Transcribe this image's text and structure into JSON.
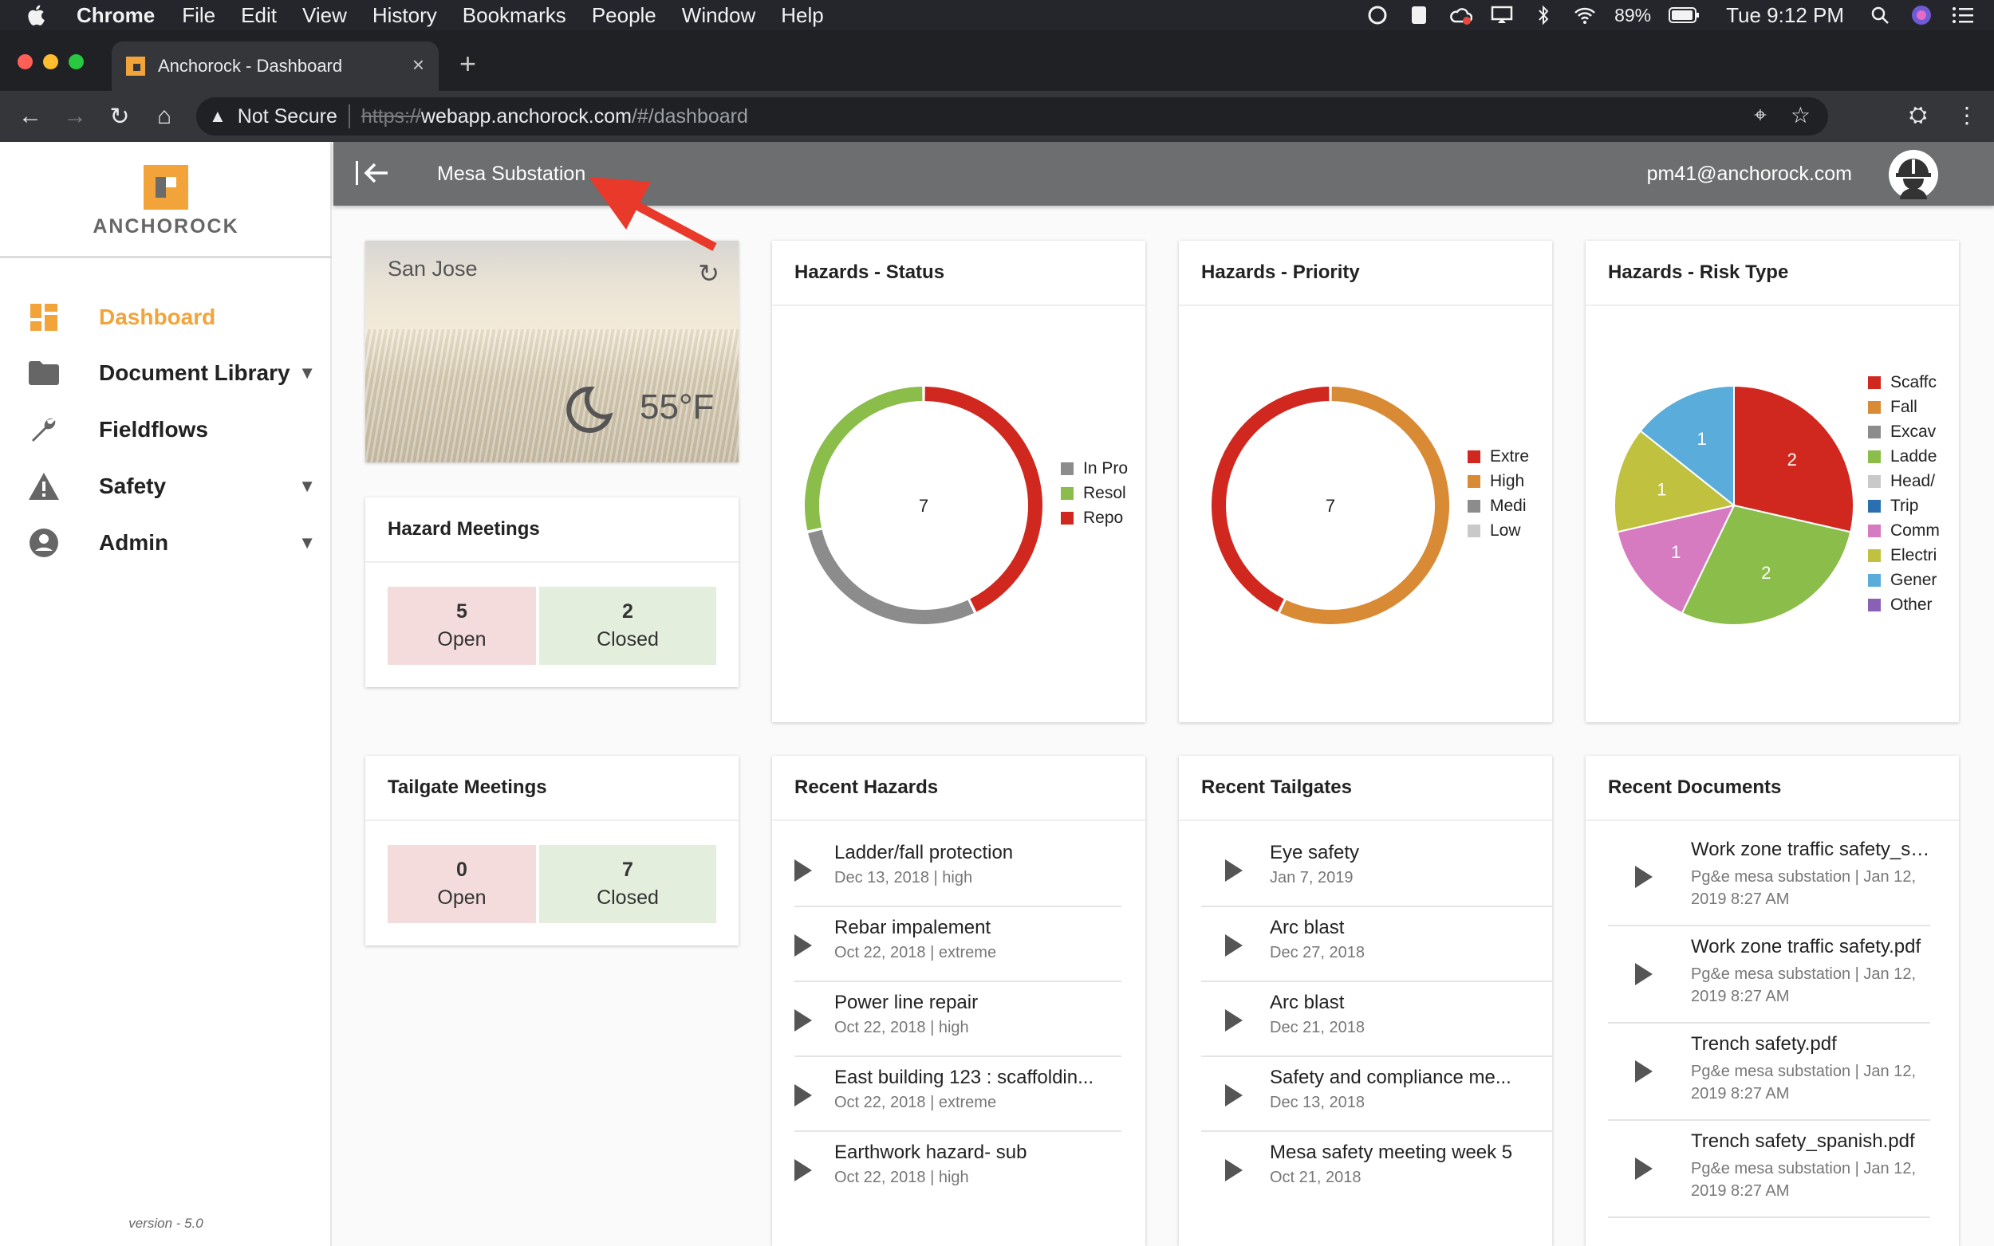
{
  "menubar": {
    "app": "Chrome",
    "items": [
      "File",
      "Edit",
      "View",
      "History",
      "Bookmarks",
      "People",
      "Window",
      "Help"
    ],
    "battery": "89%",
    "clock": "Tue 9:12 PM"
  },
  "browser": {
    "tab_title": "Anchorock - Dashboard",
    "security_label": "Not Secure",
    "url_scheme": "https://",
    "url_host": "webapp.anchorock.com",
    "url_path": "/#/dashboard"
  },
  "sidebar": {
    "brand": "ANCHOROCK",
    "items": [
      {
        "label": "Dashboard",
        "icon": "dashboard-icon",
        "active": true
      },
      {
        "label": "Document Library",
        "icon": "folder-icon",
        "expandable": true
      },
      {
        "label": "Fieldflows",
        "icon": "wrench-icon"
      },
      {
        "label": "Safety",
        "icon": "warning-icon",
        "expandable": true
      },
      {
        "label": "Admin",
        "icon": "account-icon",
        "expandable": true
      }
    ],
    "version": "version - 5.0"
  },
  "header": {
    "site": "Mesa Substation",
    "user_email": "pm41@anchorock.com"
  },
  "weather": {
    "city": "San Jose",
    "temperature": "55°F"
  },
  "hazard_meetings": {
    "title": "Hazard Meetings",
    "open_count": "5",
    "open_label": "Open",
    "closed_count": "2",
    "closed_label": "Closed"
  },
  "tailgate_meetings": {
    "title": "Tailgate Meetings",
    "open_count": "0",
    "open_label": "Open",
    "closed_count": "7",
    "closed_label": "Closed"
  },
  "colors": {
    "accent": "#f2a33a",
    "red": "#d0281f",
    "green": "#8bbd4a",
    "gray": "#8c8c8c",
    "orange": "#d98a35",
    "lightgray": "#c9c9c9",
    "blue": "#2c6fb0",
    "pink": "#d77bc0",
    "olive": "#bfc13f",
    "skyblue": "#5aaddb",
    "purple": "#8a60b5"
  },
  "chart_data": [
    {
      "type": "pie",
      "title": "Hazards - Status",
      "center_label": "7",
      "categories": [
        "In Pro",
        "Resol",
        "Repo"
      ],
      "values": [
        2,
        2,
        3
      ],
      "colors": [
        "#8c8c8c",
        "#8bbd4a",
        "#d0281f"
      ]
    },
    {
      "type": "pie",
      "title": "Hazards - Priority",
      "center_label": "7",
      "categories": [
        "Extre",
        "High",
        "Medi",
        "Low"
      ],
      "values": [
        3,
        4,
        0,
        0
      ],
      "colors": [
        "#d0281f",
        "#d98a35",
        "#8c8c8c",
        "#c9c9c9"
      ]
    },
    {
      "type": "pie",
      "title": "Hazards - Risk Type",
      "categories": [
        "Scaffc",
        "Fall",
        "Excav",
        "Ladde",
        "Head/",
        "Trip",
        "Comm",
        "Electri",
        "Gener",
        "Other"
      ],
      "values": [
        2,
        0,
        0,
        2,
        0,
        0,
        1,
        1,
        1,
        0
      ],
      "colors": [
        "#d0281f",
        "#d98a35",
        "#8c8c8c",
        "#8bbd4a",
        "#c9c9c9",
        "#2c6fb0",
        "#d77bc0",
        "#bfc13f",
        "#5aaddb",
        "#8a60b5"
      ]
    }
  ],
  "recent_hazards": {
    "title": "Recent Hazards",
    "items": [
      {
        "title": "Ladder/fall protection",
        "meta": "Dec 13, 2018 | high"
      },
      {
        "title": "Rebar impalement",
        "meta": "Oct 22, 2018 | extreme"
      },
      {
        "title": "Power line repair",
        "meta": "Oct 22, 2018 | high"
      },
      {
        "title": "East building 123 : scaffoldin...",
        "meta": "Oct 22, 2018 | extreme"
      },
      {
        "title": "Earthwork hazard- sub",
        "meta": "Oct 22, 2018 | high"
      }
    ]
  },
  "recent_tailgates": {
    "title": "Recent Tailgates",
    "items": [
      {
        "title": "Eye safety",
        "meta": "Jan 7, 2019"
      },
      {
        "title": "Arc blast",
        "meta": "Dec 27, 2018"
      },
      {
        "title": "Arc blast",
        "meta": "Dec 21, 2018"
      },
      {
        "title": "Safety and compliance me...",
        "meta": "Dec 13, 2018"
      },
      {
        "title": "Mesa safety meeting week 5",
        "meta": "Oct 21, 2018"
      }
    ]
  },
  "recent_documents": {
    "title": "Recent Documents",
    "items": [
      {
        "title": "Work zone traffic safety_sp...",
        "meta": "Pg&e mesa substation | Jan 12, 2019 8:27 AM"
      },
      {
        "title": "Work zone traffic safety.pdf",
        "meta": "Pg&e mesa substation | Jan 12, 2019 8:27 AM"
      },
      {
        "title": "Trench safety.pdf",
        "meta": "Pg&e mesa substation | Jan 12, 2019 8:27 AM"
      },
      {
        "title": "Trench safety_spanish.pdf",
        "meta": "Pg&e mesa substation | Jan 12, 2019 8:27 AM"
      }
    ]
  }
}
